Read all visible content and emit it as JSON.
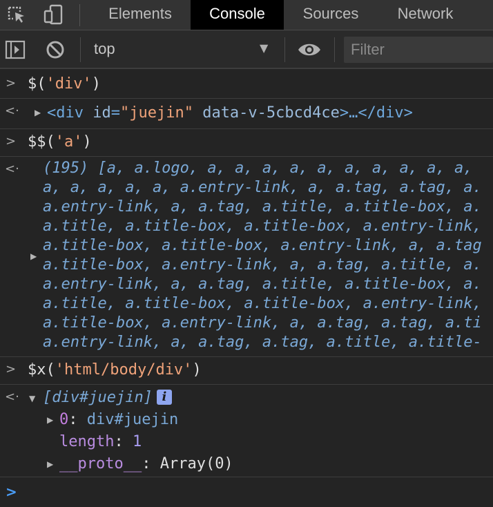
{
  "tabs": [
    {
      "label": "Elements"
    },
    {
      "label": "Console"
    },
    {
      "label": "Sources"
    },
    {
      "label": "Network"
    }
  ],
  "toolbar": {
    "context": "top",
    "filter_placeholder": "Filter"
  },
  "console": {
    "cmd1": {
      "fn": "$(",
      "arg": "'div'",
      "close": ")"
    },
    "res1": {
      "open": "<div ",
      "attr1": "id",
      "eq": "=",
      "val1": "\"juejin\"",
      "attr2": " data-v-5cbcd4ce",
      "close": ">…</div>"
    },
    "cmd2": {
      "fn": "$$(",
      "arg": "'a'",
      "close": ")"
    },
    "res2_lines": [
      "(195) [a, a.logo, a, a, a, a, a, a, a, a, a, a,",
      "a, a, a, a, a, a.entry-link, a, a.tag, a.tag, a.",
      "a.entry-link, a, a.tag, a.title, a.title-box, a.",
      "a.title, a.title-box, a.title-box, a.entry-link,",
      "a.title-box, a.title-box, a.entry-link, a, a.tag",
      "a.title-box, a.entry-link, a, a.tag, a.title, a.",
      "a.entry-link, a, a.tag, a.title, a.title-box, a.",
      "a.title, a.title-box, a.title-box, a.entry-link,",
      "a.title-box, a.entry-link, a, a.tag, a.tag, a.ti",
      "a.entry-link, a, a.tag, a.tag, a.title, a.title-"
    ],
    "cmd3": {
      "fn": "$x(",
      "arg": "'html/body/div'",
      "close": ")"
    },
    "res3": {
      "summary": "[div#juejin]",
      "info": "i",
      "item0_key": "0",
      "item0_val": "div#juejin",
      "length_key": "length",
      "length_val": "1",
      "proto_key": "__proto__",
      "proto_val": "Array(0)",
      "colon": ": "
    }
  }
}
